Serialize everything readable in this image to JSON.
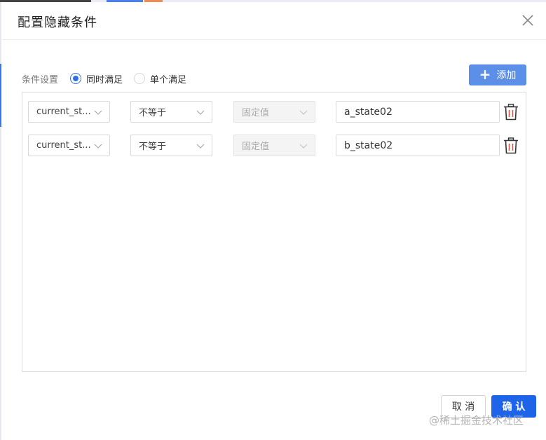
{
  "dialog": {
    "title": "配置隐藏条件"
  },
  "condition": {
    "label": "条件设置",
    "options": [
      {
        "label": "同时满足",
        "checked": true
      },
      {
        "label": "单个满足",
        "checked": false
      }
    ]
  },
  "add_button": {
    "label": "添加"
  },
  "rules": [
    {
      "field": "current_st...",
      "operator": "不等于",
      "value_type": "固定值",
      "value": "a_state02"
    },
    {
      "field": "current_st...",
      "operator": "不等于",
      "value_type": "固定值",
      "value": "b_state02"
    }
  ],
  "footer": {
    "cancel_label": "取 消",
    "ok_label": "确 认"
  },
  "watermark": "@稀土掘金技术社区",
  "colors": {
    "primary": "#1e64e8",
    "add_button": "#5b8fe8",
    "radio_checked": "#2f6fe4",
    "trash_accent": "#e0543f"
  }
}
